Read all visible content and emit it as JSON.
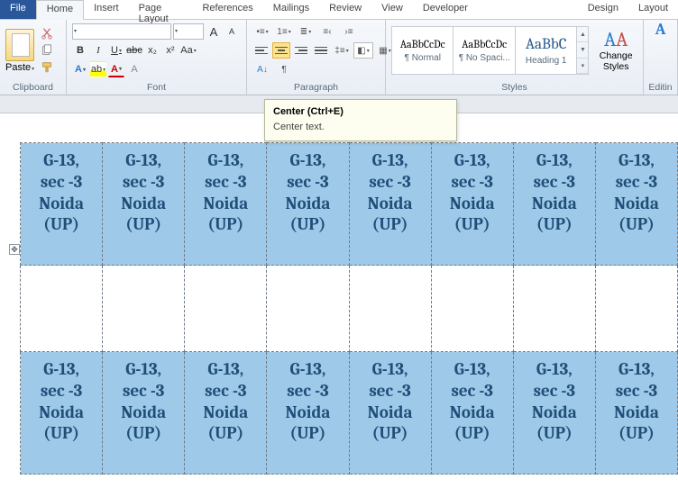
{
  "tabs": {
    "file": "File",
    "home": "Home",
    "insert": "Insert",
    "page_layout": "Page Layout",
    "references": "References",
    "mailings": "Mailings",
    "review": "Review",
    "view": "View",
    "developer": "Developer",
    "design": "Design",
    "layout": "Layout"
  },
  "clipboard": {
    "paste": "Paste",
    "group": "Clipboard"
  },
  "font": {
    "group": "Font",
    "bold": "B",
    "italic": "I",
    "underline": "U",
    "strike": "abc",
    "sub": "x₂",
    "sup": "x²",
    "grow": "A",
    "shrink": "A",
    "case": "Aa",
    "clear": "A"
  },
  "paragraph": {
    "group": "Paragraph"
  },
  "styles": {
    "group": "Styles",
    "tiles": [
      {
        "preview": "AaBbCcDc",
        "name": "¶ Normal"
      },
      {
        "preview": "AaBbCcDc",
        "name": "¶ No Spaci..."
      },
      {
        "preview": "AaBbC",
        "name": "Heading 1"
      }
    ],
    "change": "Change Styles"
  },
  "editing": {
    "label": "Editin",
    "find_icon": "A"
  },
  "tooltip": {
    "title": "Center (Ctrl+E)",
    "body": "Center text."
  },
  "cell_lines": [
    "G-13,",
    "sec -3",
    "Noida",
    "(UP)"
  ],
  "chart_data": {
    "type": "table",
    "description": "Word mailing-labels table, 8 columns × 2 filled rows (row 3 blank), each filled cell repeats the same address",
    "columns": 8,
    "rows": 3,
    "blank_rows": [
      1
    ],
    "cell_value": "G-13, sec -3 Noida (UP)",
    "selected_cells": "all filled cells highlighted"
  }
}
